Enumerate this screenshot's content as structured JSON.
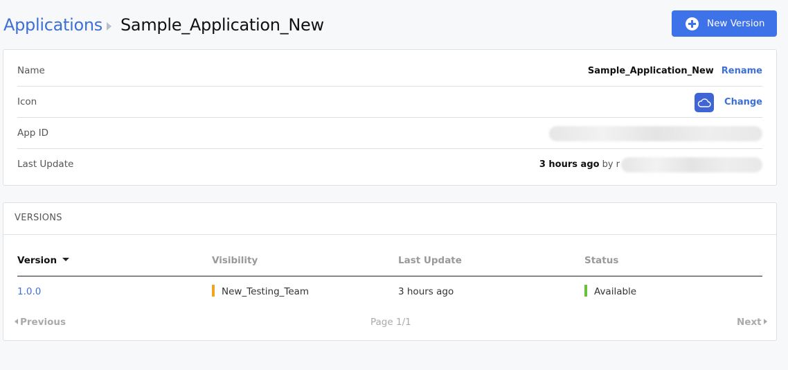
{
  "breadcrumb": {
    "parent": "Applications",
    "current": "Sample_Application_New"
  },
  "header": {
    "new_version_label": "New Version"
  },
  "details": {
    "name_label": "Name",
    "name_value": "Sample_Application_New",
    "rename_label": "Rename",
    "icon_label": "Icon",
    "icon_name": "cloud-icon",
    "change_label": "Change",
    "app_id_label": "App ID",
    "last_update_label": "Last Update",
    "last_update_value": "3 hours ago",
    "last_update_by": "by r"
  },
  "versions": {
    "title": "VERSIONS",
    "columns": [
      "Version",
      "Visibility",
      "Last Update",
      "Status"
    ],
    "rows": [
      {
        "version": "1.0.0",
        "visibility": "New_Testing_Team",
        "last_update": "3 hours ago",
        "status": "Available"
      }
    ],
    "pager": {
      "previous": "Previous",
      "page": "Page 1/1",
      "next": "Next"
    }
  },
  "colors": {
    "accent": "#3e72e8",
    "link": "#3d6fd6",
    "visibility_bar": "#f0a522",
    "status_available": "#67c23a"
  }
}
